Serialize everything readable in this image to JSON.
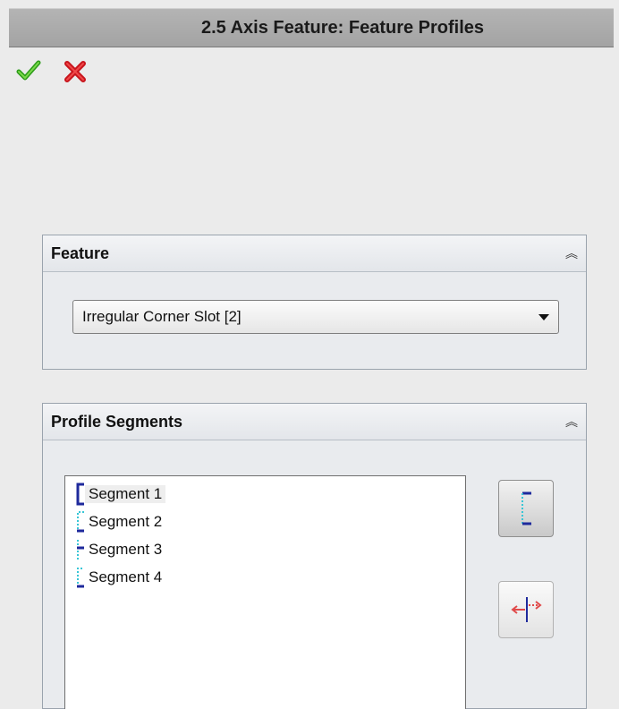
{
  "window": {
    "title": "2.5 Axis Feature: Feature Profiles"
  },
  "actions": {
    "ok_icon": "checkmark-icon",
    "cancel_icon": "x-icon"
  },
  "feature_group": {
    "title": "Feature",
    "selected_feature": "Irregular Corner Slot [2]"
  },
  "segments_group": {
    "title": "Profile Segments",
    "items": [
      {
        "label": "Segment 1",
        "selected": true
      },
      {
        "label": "Segment 2",
        "selected": false
      },
      {
        "label": "Segment 3",
        "selected": false
      },
      {
        "label": "Segment 4",
        "selected": false
      }
    ],
    "tools": [
      "segment-profile-icon",
      "direction-arrows-icon"
    ]
  },
  "colors": {
    "accent_blue": "#1f2a9c",
    "accent_cyan": "#38c6d6",
    "accent_red": "#e04a4a"
  }
}
